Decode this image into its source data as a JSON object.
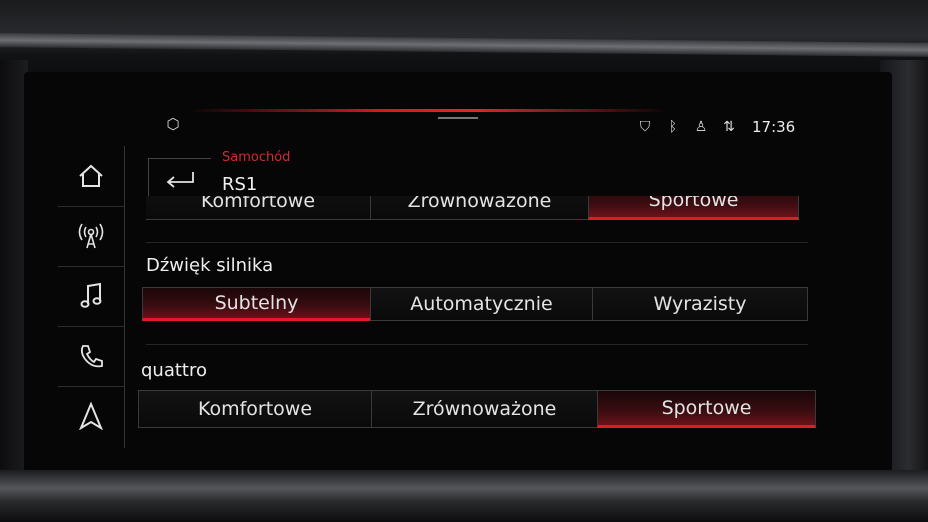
{
  "status": {
    "time": "17:36",
    "left_icon": "cube-icon",
    "icons": [
      "shield-icon",
      "bluetooth-icon",
      "person-icon",
      "signal-icon"
    ]
  },
  "nav": {
    "items": [
      {
        "icon": "home-icon",
        "glyph": "⌂"
      },
      {
        "icon": "radio-icon",
        "glyph": "((·))"
      },
      {
        "icon": "music-icon",
        "glyph": "♫"
      },
      {
        "icon": "phone-icon",
        "glyph": "✆"
      },
      {
        "icon": "navigation-icon",
        "glyph": "▲"
      }
    ]
  },
  "header": {
    "breadcrumb": "Samochód",
    "title": "RS1",
    "back_glyph": "↵"
  },
  "drive_mode_partial": {
    "options": [
      "Komfortowe",
      "Zrównoważone",
      "Sportowe"
    ],
    "selected": "Sportowe"
  },
  "engine_sound": {
    "label": "Dźwięk silnika",
    "options": [
      "Subtelny",
      "Automatycznie",
      "Wyrazisty"
    ],
    "selected": "Subtelny"
  },
  "quattro": {
    "label": "quattro",
    "options": [
      "Komfortowe",
      "Zrównoważone",
      "Sportowe"
    ],
    "selected": "Sportowe"
  },
  "colors": {
    "accent_red": "#e01c28",
    "breadcrumb_red": "#d42a30",
    "background": "#060607",
    "text": "#e6e6e6"
  }
}
